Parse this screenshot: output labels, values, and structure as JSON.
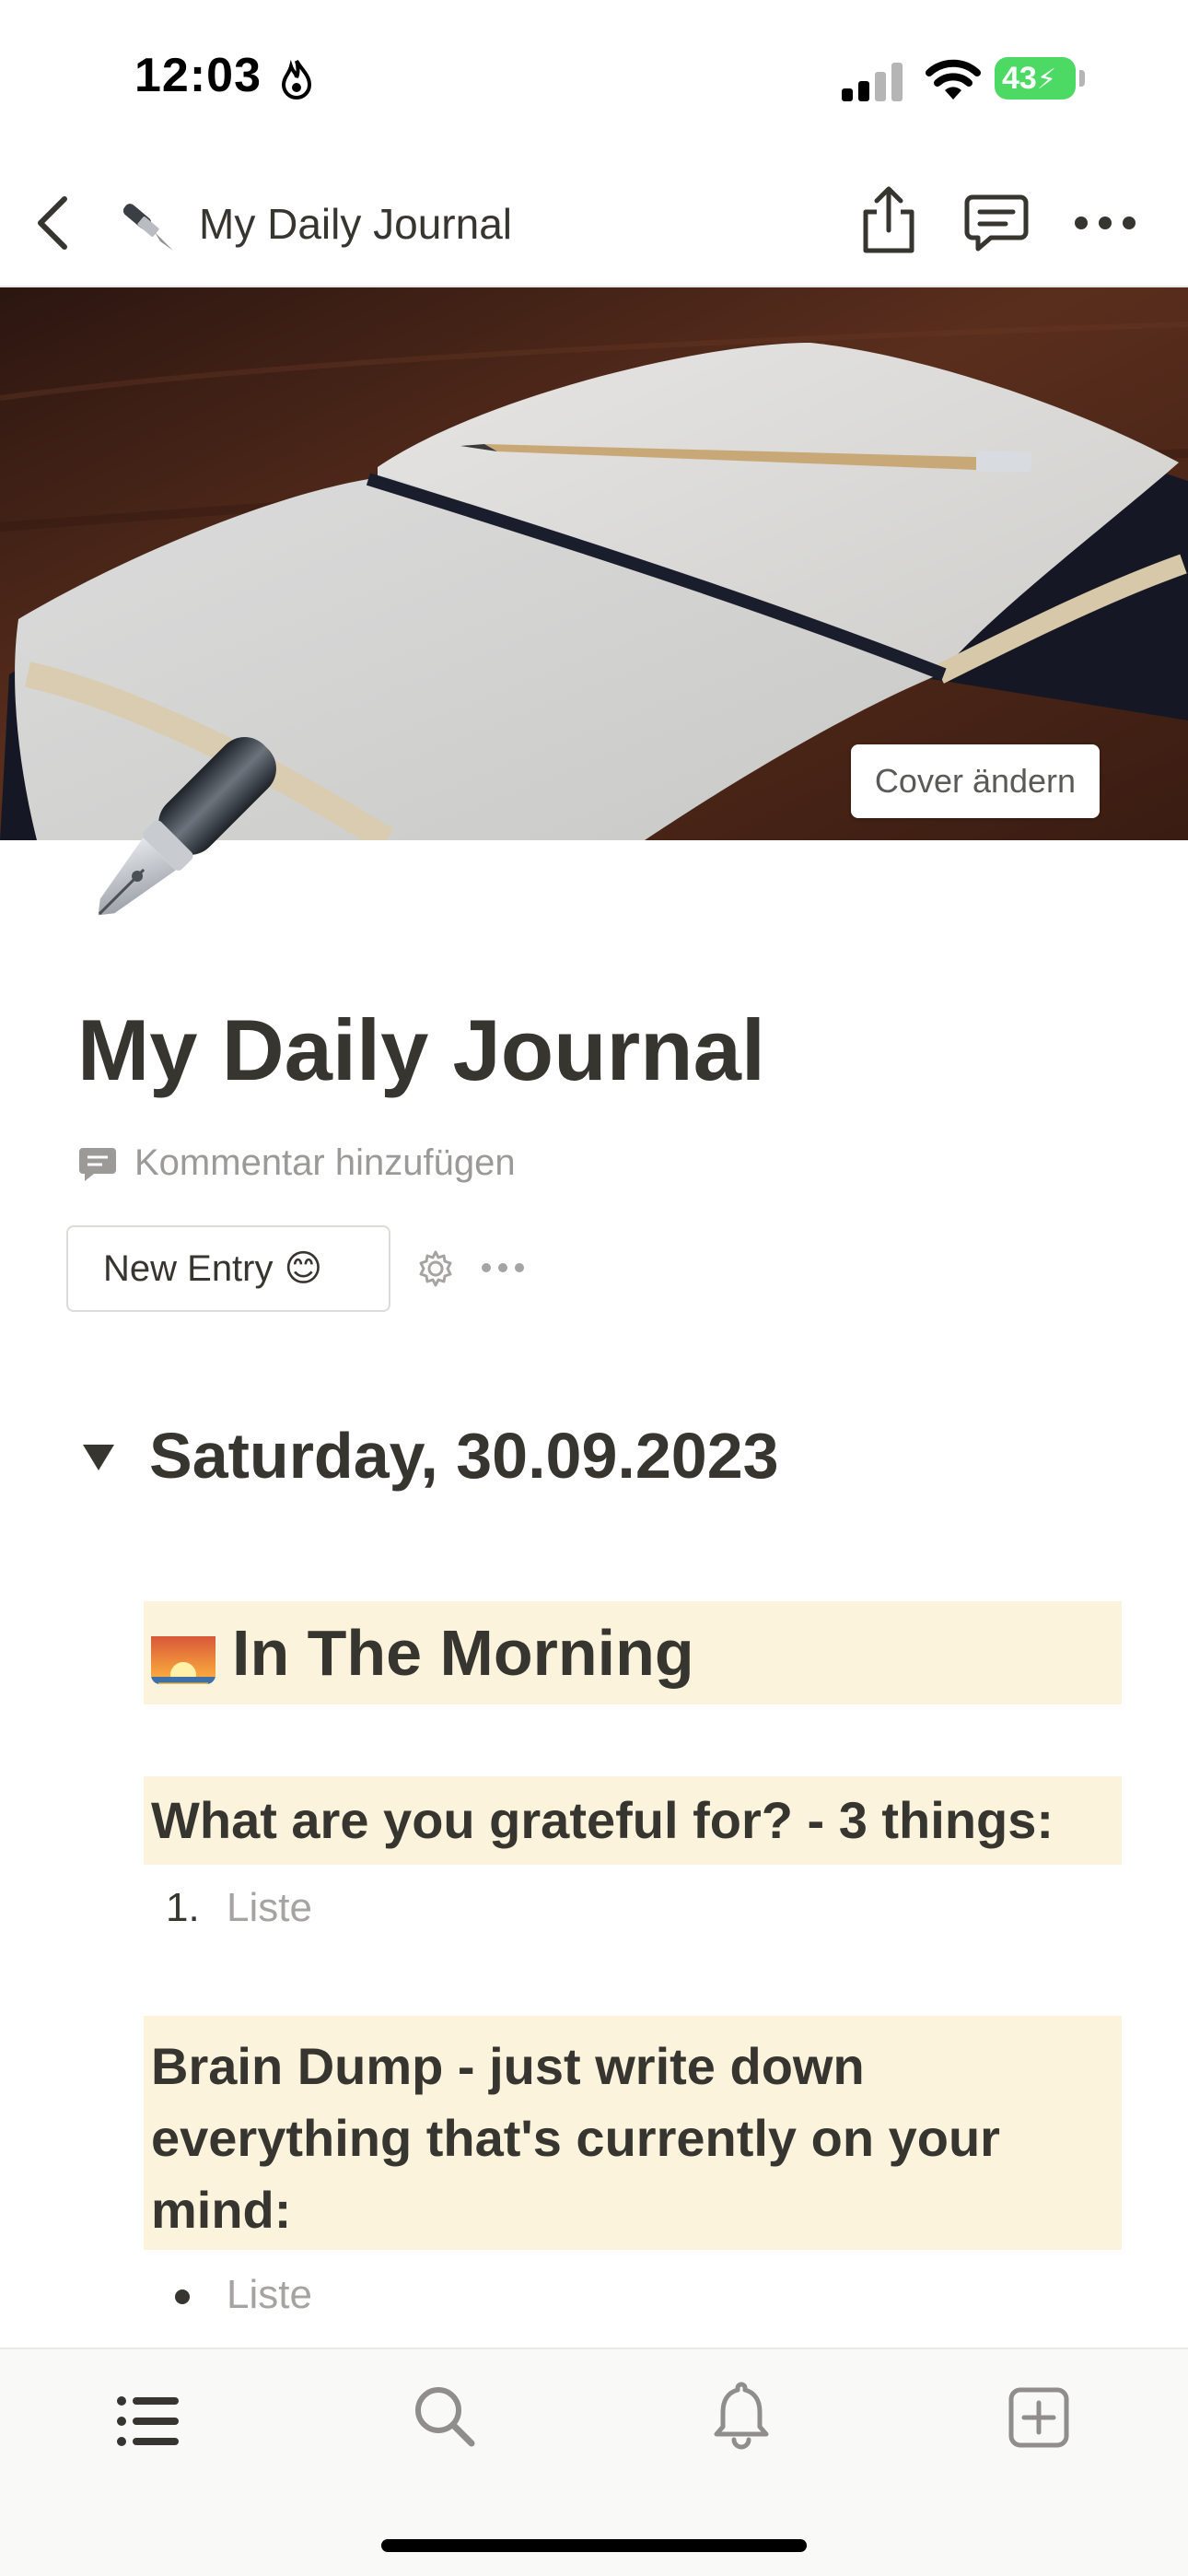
{
  "status_bar": {
    "time": "12:03",
    "battery": "43"
  },
  "top_nav": {
    "title": "My Daily Journal",
    "icons": [
      "back-icon",
      "pen-icon",
      "share-icon",
      "comments-icon",
      "more-icon"
    ]
  },
  "cover": {
    "change_cover_label": "Cover ändern"
  },
  "page": {
    "title": "My Daily Journal",
    "add_comment_label": "Kommentar hinzufügen",
    "template_button_label": "New Entry",
    "template_button_emoji": "😊"
  },
  "entry": {
    "date_heading": "Saturday, 30.09.2023",
    "morning_heading": "In The Morning",
    "grateful_heading": "What are you grateful for? - 3 things:",
    "grateful_list_number": "1.",
    "grateful_list_placeholder": "Liste",
    "braindump_heading": "Brain Dump - just write down everything that's currently on your mind:",
    "braindump_list_placeholder": "Liste"
  },
  "tab_bar": {
    "icons": [
      "list-icon",
      "search-icon",
      "bell-icon",
      "new-page-icon"
    ]
  },
  "colors": {
    "text": "#37352f",
    "muted": "#9b9a97",
    "highlight": "#fbf3db",
    "battery": "#4cd964"
  }
}
